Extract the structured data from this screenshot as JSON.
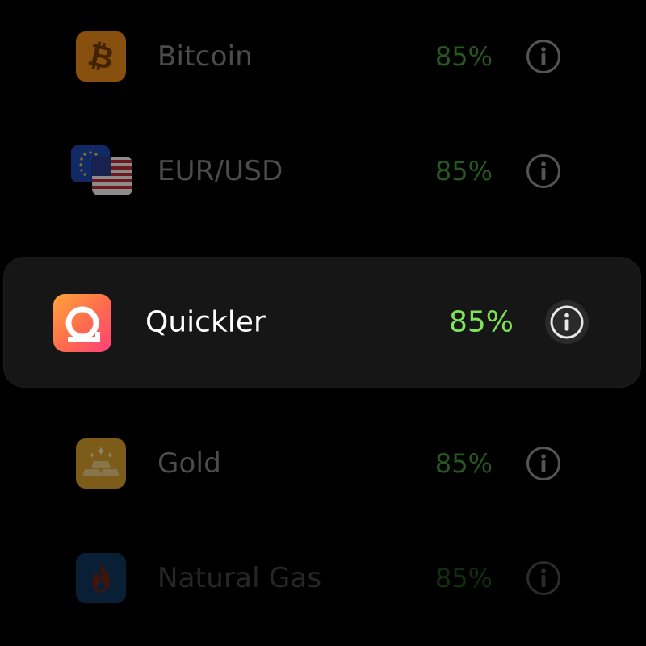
{
  "colors": {
    "background": "#000000",
    "payout_green": "#44a336",
    "payout_green_active": "#7ee35a",
    "selected_card": "#161616"
  },
  "assets": [
    {
      "name": "Bitcoin",
      "payout": "85%",
      "icon": "bitcoin-icon"
    },
    {
      "name": "EUR/USD",
      "payout": "85%",
      "icon": "eur-usd-flags-icon"
    },
    {
      "name": "Quickler",
      "payout": "85%",
      "icon": "quickler-logo-icon",
      "selected": true
    },
    {
      "name": "Gold",
      "payout": "85%",
      "icon": "gold-bars-icon"
    },
    {
      "name": "Natural Gas",
      "payout": "85%",
      "icon": "flame-icon"
    }
  ]
}
